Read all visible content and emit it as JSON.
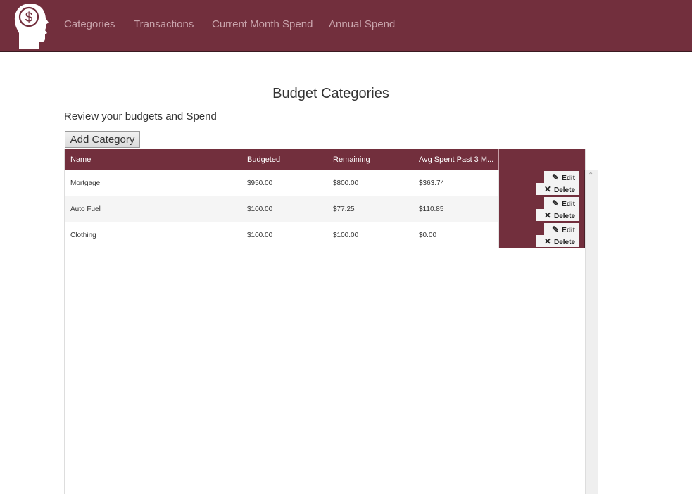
{
  "nav": {
    "items": [
      {
        "label": "Categories"
      },
      {
        "label": "Transactions"
      },
      {
        "label": "Current Month Spend"
      },
      {
        "label": "Annual Spend"
      }
    ]
  },
  "page": {
    "title": "Budget Categories",
    "subtitle": "Review your budgets and Spend",
    "add_button": "Add Category"
  },
  "grid": {
    "columns": [
      "Name",
      "Budgeted",
      "Remaining",
      "Avg Spent Past 3 M..."
    ],
    "rows": [
      {
        "name": "Mortgage",
        "budgeted": "$950.00",
        "remaining": "$800.00",
        "avg": "$363.74"
      },
      {
        "name": "Auto Fuel",
        "budgeted": "$100.00",
        "remaining": "$77.25",
        "avg": "$110.85"
      },
      {
        "name": "Clothing",
        "budgeted": "$100.00",
        "remaining": "$100.00",
        "avg": "$0.00"
      }
    ],
    "edit_label": "Edit",
    "delete_label": "Delete"
  },
  "colors": {
    "brand": "#722f3d",
    "nav_text": "#c9a4ac",
    "alt_row": "#f5f5f5"
  },
  "icons": [
    "brain-dollar-logo-icon",
    "pencil-icon",
    "x-icon",
    "scroll-up-arrow-icon"
  ]
}
